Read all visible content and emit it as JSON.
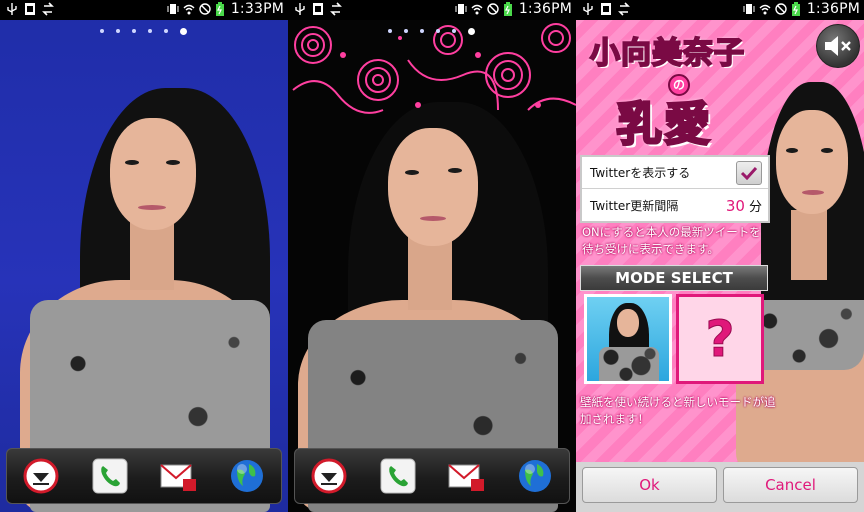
{
  "screens": [
    {
      "status": {
        "time": "1:33PM"
      },
      "page_dots": {
        "count": 6,
        "active": 5
      }
    },
    {
      "status": {
        "time": "1:36PM"
      },
      "page_dots": {
        "count": 6,
        "active": 5
      }
    },
    {
      "status": {
        "time": "1:36PM"
      }
    }
  ],
  "dock": {
    "items": [
      "drawer-icon",
      "phone-icon",
      "mail-icon",
      "browser-icon"
    ]
  },
  "app": {
    "logo": {
      "line1": "小向美奈子",
      "no": "の",
      "line2": "乳愛"
    },
    "settings": {
      "twitter_show_label": "Twitterを表示する",
      "twitter_show_checked": true,
      "twitter_interval_label": "Twitter更新間隔",
      "twitter_interval_value": "30",
      "twitter_interval_unit": "分"
    },
    "note": "ONにすると本人の最新ツイートを待ち受けに表示できます。",
    "mode_select_label": "MODE SELECT",
    "locked_mode": "?",
    "mode_note": "壁紙を使い続けると新しいモードが追加されます！",
    "ok_label": "Ok",
    "cancel_label": "Cancel"
  },
  "colors": {
    "accent": "#e0187a",
    "p1_background": "#2733b9",
    "p3_background": "#ff8cc8"
  }
}
